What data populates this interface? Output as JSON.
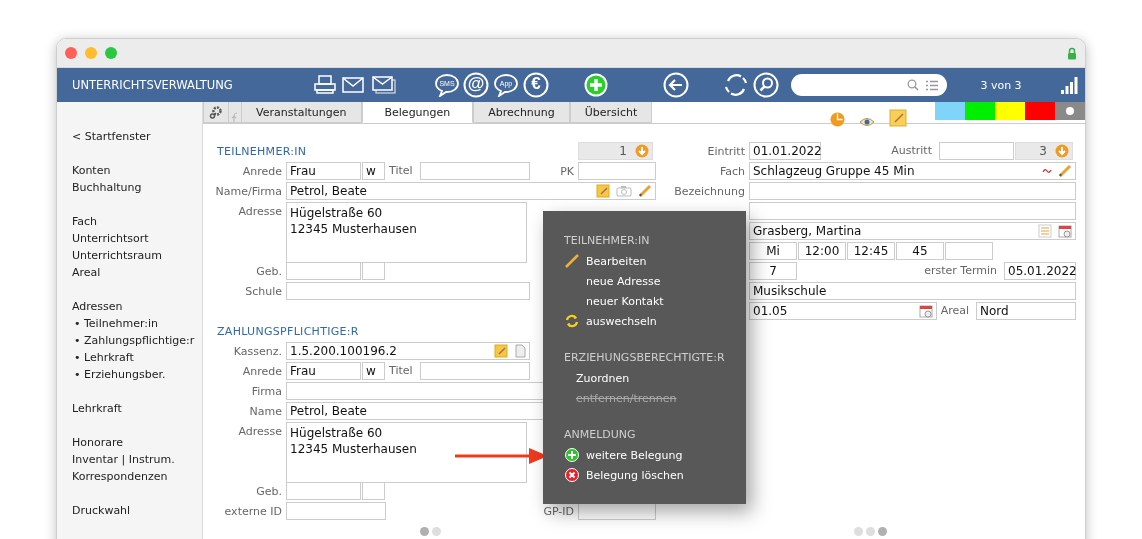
{
  "app_title": "UNTERRICHTSVERWALTUNG",
  "toolbar": [
    {
      "kind": "printer"
    },
    {
      "kind": "mail"
    },
    {
      "kind": "mails"
    },
    {
      "kind": "bubble",
      "label": "SMS"
    },
    {
      "kind": "ring",
      "label": "@"
    },
    {
      "kind": "bubble",
      "label": "App"
    },
    {
      "kind": "ring",
      "label": "€"
    },
    {
      "kind": "add"
    },
    {
      "kind": "back"
    },
    {
      "kind": "refresh"
    },
    {
      "kind": "search"
    }
  ],
  "record_counter": "3 von 3",
  "sidebar": {
    "groups": [
      {
        "items": [
          {
            "label": "< Startfenster",
            "kind": "link"
          }
        ]
      },
      {
        "items": [
          {
            "label": "Konten",
            "kind": "link"
          },
          {
            "label": "Buchhaltung",
            "kind": "link"
          }
        ]
      },
      {
        "items": [
          {
            "label": "Fach",
            "kind": "link"
          },
          {
            "label": "Unterrichtsort",
            "kind": "link"
          },
          {
            "label": "Unterrichtsraum",
            "kind": "link"
          },
          {
            "label": "Areal",
            "kind": "link"
          }
        ]
      },
      {
        "items": [
          {
            "label": "Adressen",
            "kind": "link"
          },
          {
            "label": "• Teilnehmer:in",
            "kind": "sub"
          },
          {
            "label": "• Zahlungspflichtige:r",
            "kind": "sub"
          },
          {
            "label": "• Lehrkraft",
            "kind": "sub"
          },
          {
            "label": "• Erziehungsber.",
            "kind": "sub"
          }
        ]
      },
      {
        "items": [
          {
            "label": "Lehrkraft",
            "kind": "link"
          }
        ]
      },
      {
        "items": [
          {
            "label": "Honorare",
            "kind": "link"
          },
          {
            "label": "Inventar | Instrum.",
            "kind": "link"
          },
          {
            "label": "Korrespondenzen",
            "kind": "link"
          }
        ]
      },
      {
        "items": [
          {
            "label": "Druckwahl",
            "kind": "link"
          }
        ]
      }
    ]
  },
  "tabs": [
    {
      "label": "Veranstaltungen",
      "selected": false
    },
    {
      "label": "Belegungen",
      "selected": true
    },
    {
      "label": "Abrechnung",
      "selected": false
    },
    {
      "label": "Übersicht",
      "selected": false
    }
  ],
  "color_tags": [
    {
      "color": "#80d4f8",
      "selected": false
    },
    {
      "color": "#00ee00",
      "selected": false
    },
    {
      "color": "#ffff00",
      "selected": false
    },
    {
      "color": "#ff0000",
      "selected": false
    },
    {
      "color": "#8a8a8a",
      "selected": true
    }
  ],
  "form": {
    "left": [
      {
        "kind": "header",
        "label": "TEILNEHMER:IN"
      },
      {
        "kind": "row",
        "label": "Anrede",
        "parts": [
          {
            "kind": "short",
            "value": "Frau"
          },
          {
            "kind": "tiny",
            "value": "w"
          },
          {
            "kind": "label",
            "text": "Titel"
          },
          {
            "kind": "field"
          }
        ]
      },
      {
        "kind": "wide",
        "label": "Name/Firma",
        "parts": [
          {
            "kind": "field",
            "value": "Petrol, Beate",
            "icons": [
              {
                "kind": "note"
              },
              {
                "kind": "camera"
              },
              {
                "kind": "pencil"
              }
            ]
          }
        ]
      },
      {
        "kind": "area",
        "label": "Adresse",
        "value": "Hügelstraße 60\n12345 Musterhausen"
      },
      {
        "kind": "row",
        "label": "Geb.",
        "parts": [
          {
            "kind": "short"
          },
          {
            "kind": "tiny"
          }
        ]
      },
      {
        "kind": "row",
        "label": "Schule",
        "parts": [
          {
            "kind": "field"
          }
        ]
      },
      {
        "kind": "gap"
      },
      {
        "kind": "header",
        "label": "ZAHLUNGSPFLICHTIGE:R"
      },
      {
        "kind": "row",
        "label": "Kassenz.",
        "parts": [
          {
            "kind": "field",
            "value": "1.5.200.100196.2",
            "icons": [
              {
                "kind": "note"
              },
              {
                "kind": "page"
              }
            ]
          }
        ]
      },
      {
        "kind": "row",
        "label": "Anrede",
        "parts": [
          {
            "kind": "short",
            "value": "Frau"
          },
          {
            "kind": "tiny",
            "value": "w"
          },
          {
            "kind": "label",
            "text": "Titel"
          },
          {
            "kind": "field"
          }
        ]
      },
      {
        "kind": "wide",
        "label": "Firma",
        "parts": [
          {
            "kind": "field"
          }
        ]
      },
      {
        "kind": "wide",
        "label": "Name",
        "parts": [
          {
            "kind": "field",
            "value": "Petrol, Beate"
          }
        ]
      },
      {
        "kind": "area",
        "label": "Adresse",
        "value": "Hügelstraße 60\n12345 Musterhausen"
      },
      {
        "kind": "row",
        "label": "Geb.",
        "parts": [
          {
            "kind": "short"
          },
          {
            "kind": "tiny"
          }
        ]
      },
      {
        "kind": "row",
        "label": "externe ID",
        "parts": [
          {
            "kind": "medium"
          }
        ]
      }
    ],
    "middle": [
      {
        "kind": "row",
        "parts": [
          {
            "kind": "counter",
            "value": "1"
          }
        ]
      },
      {
        "kind": "row",
        "label": "PK",
        "parts": [
          {
            "kind": "field"
          }
        ]
      },
      {
        "kind": "gap"
      },
      {
        "kind": "gap"
      },
      {
        "kind": "gap"
      },
      {
        "kind": "gap"
      },
      {
        "kind": "gap"
      },
      {
        "kind": "gap"
      },
      {
        "kind": "gap"
      },
      {
        "kind": "gap"
      },
      {
        "kind": "gap"
      },
      {
        "kind": "gap"
      },
      {
        "kind": "gap"
      },
      {
        "kind": "gap"
      },
      {
        "kind": "gap"
      },
      {
        "kind": "gap"
      },
      {
        "kind": "gap"
      },
      {
        "kind": "gap"
      },
      {
        "kind": "row",
        "label": "GP-ID",
        "parts": [
          {
            "kind": "field"
          }
        ]
      }
    ],
    "right": [
      {
        "kind": "row",
        "label": "Eintritt",
        "parts": [
          {
            "kind": "date",
            "value": "01.01.2022"
          },
          {
            "kind": "rlabel",
            "text": "Austritt"
          },
          {
            "kind": "short"
          },
          {
            "kind": "counter",
            "value": "3"
          }
        ]
      },
      {
        "kind": "row",
        "label": "Fach",
        "parts": [
          {
            "kind": "field",
            "value": "Schlagzeug Gruppe 45 Min",
            "icons": [
              {
                "kind": "tilde"
              },
              {
                "kind": "pencil"
              }
            ]
          }
        ]
      },
      {
        "kind": "row",
        "label": "Bezeichnung",
        "parts": [
          {
            "kind": "field"
          }
        ]
      },
      {
        "kind": "row",
        "parts": [
          {
            "kind": "field"
          }
        ]
      },
      {
        "kind": "row",
        "parts": [
          {
            "kind": "field",
            "value": "Grasberg, Martina",
            "icons": [
              {
                "kind": "list"
              },
              {
                "kind": "calendar"
              }
            ]
          }
        ]
      },
      {
        "kind": "row",
        "parts": [
          {
            "kind": "cell",
            "value": "Mi"
          },
          {
            "kind": "cell",
            "value": "12:00"
          },
          {
            "kind": "cell",
            "value": "12:45"
          },
          {
            "kind": "cell",
            "value": "45"
          },
          {
            "kind": "cell"
          }
        ]
      },
      {
        "kind": "row",
        "parts": [
          {
            "kind": "cell",
            "value": "7"
          },
          {
            "kind": "rlabel",
            "text": "erster Termin"
          },
          {
            "kind": "date",
            "value": "05.01.2022"
          }
        ]
      },
      {
        "kind": "row",
        "parts": [
          {
            "kind": "field",
            "value": "Musikschule"
          }
        ]
      },
      {
        "kind": "row",
        "parts": [
          {
            "kind": "field",
            "value": "01.05",
            "icons": [
              {
                "kind": "calendar"
              }
            ]
          },
          {
            "kind": "label",
            "text": "Areal"
          },
          {
            "kind": "medium",
            "value": "Nord"
          }
        ]
      }
    ]
  },
  "context_menu": {
    "sections": [
      {
        "title": "TEILNEHMER:IN",
        "items": [
          {
            "label": "Bearbeiten",
            "kind": "edit",
            "disabled": false
          },
          {
            "label": "neue Adresse",
            "kind": "plain",
            "disabled": false
          },
          {
            "label": "neuer Kontakt",
            "kind": "plain",
            "disabled": false
          },
          {
            "label": "auswechseln",
            "kind": "swap",
            "disabled": false
          }
        ]
      },
      {
        "title": "ERZIEHUNGSBERECHTIGTE:R",
        "items": [
          {
            "label": "Zuordnen",
            "kind": "plain",
            "disabled": false
          },
          {
            "label": "entfernen/trennen",
            "kind": "plain",
            "disabled": true
          }
        ]
      },
      {
        "title": "ANMELDUNG",
        "items": [
          {
            "label": "weitere Belegung",
            "kind": "add",
            "disabled": false
          },
          {
            "label": "Belegung löschen",
            "kind": "delete",
            "disabled": false
          }
        ]
      }
    ]
  },
  "pagers": [
    {
      "pages": [
        {
          "selected": true
        },
        {
          "selected": false
        }
      ]
    },
    {
      "pages": [
        {
          "selected": false
        },
        {
          "selected": false
        },
        {
          "selected": true
        }
      ]
    }
  ]
}
